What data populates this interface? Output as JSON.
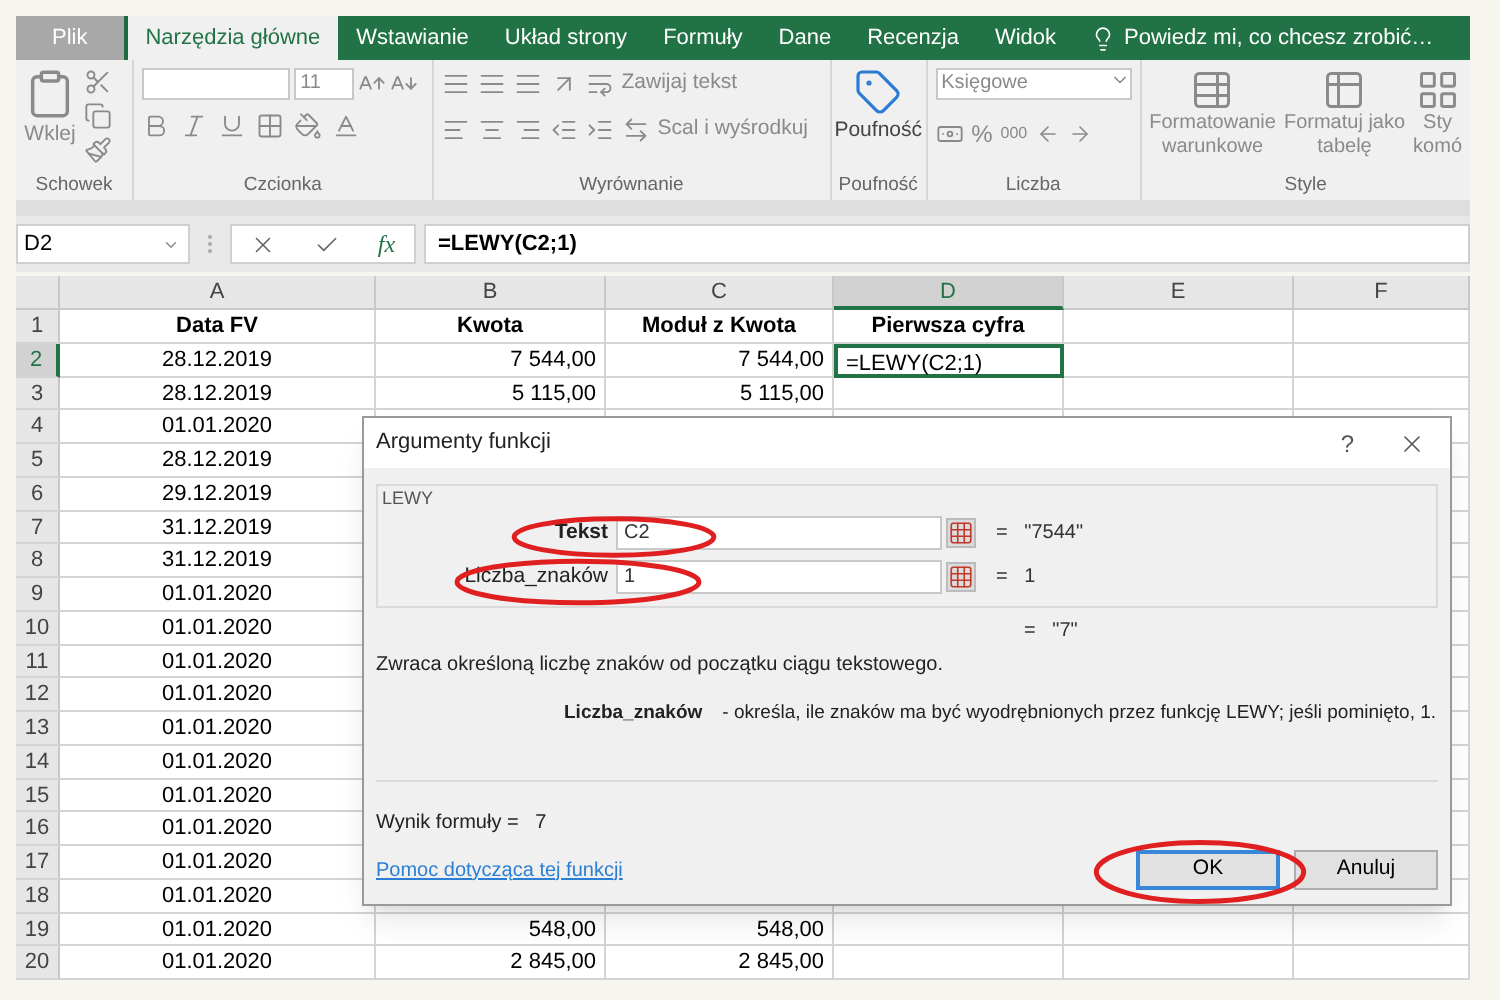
{
  "ribbon_tabs": [
    {
      "label": "Plik",
      "selected": false,
      "kind": "file"
    },
    {
      "label": "Narzędzia główne",
      "selected": true,
      "kind": "tab"
    },
    {
      "label": "Wstawianie",
      "selected": false,
      "kind": "tab"
    },
    {
      "label": "Układ strony",
      "selected": false,
      "kind": "tab"
    },
    {
      "label": "Formuły",
      "selected": false,
      "kind": "tab"
    },
    {
      "label": "Dane",
      "selected": false,
      "kind": "tab"
    },
    {
      "label": "Recenzja",
      "selected": false,
      "kind": "tab"
    },
    {
      "label": "Widok",
      "selected": false,
      "kind": "tab"
    }
  ],
  "tell_me": "Powiedz mi, co chcesz zrobić…",
  "ribbon": {
    "clipboard": {
      "paste": "Wklej",
      "label": "Schowek"
    },
    "font": {
      "size": "11",
      "label": "Czcionka"
    },
    "alignment": {
      "wrap": "Zawijaj tekst",
      "merge": "Scal i wyśrodkuj",
      "label": "Wyrównanie"
    },
    "sensitivity": {
      "button": "Poufność",
      "label": "Poufność"
    },
    "number": {
      "format": "Księgowe",
      "percent": "%",
      "thousands": "000",
      "label": "Liczba"
    },
    "styles": {
      "buttons": [
        {
          "lines": [
            "Formatowanie",
            "warunkowe"
          ]
        },
        {
          "lines": [
            "Formatuj jako",
            "tabelę"
          ]
        },
        {
          "lines": [
            "Sty",
            "komó"
          ]
        }
      ],
      "label": "Style"
    }
  },
  "formula_bar": {
    "name_box": "D2",
    "function_button": "fx",
    "formula": "=LEWY(C2;1)"
  },
  "columns": [
    {
      "label": "A",
      "selected": false
    },
    {
      "label": "B",
      "selected": false
    },
    {
      "label": "C",
      "selected": false
    },
    {
      "label": "D",
      "selected": true
    },
    {
      "label": "E",
      "selected": false
    },
    {
      "label": "F",
      "selected": false
    }
  ],
  "rows": [
    {
      "number": "1",
      "selected": false,
      "kind": "header",
      "cells": [
        "Data FV",
        "Kwota",
        "Moduł z Kwota",
        "Pierwsza cyfra"
      ]
    },
    {
      "number": "2",
      "selected": true,
      "kind": "data",
      "cells": [
        "28.12.2019",
        "7 544,00",
        "7 544,00",
        "=LEWY(C2;1)"
      ]
    },
    {
      "number": "3",
      "selected": false,
      "kind": "data",
      "cells": [
        "28.12.2019",
        "5 115,00",
        "5 115,00"
      ]
    },
    {
      "number": "4",
      "selected": false,
      "kind": "data",
      "cells": [
        "01.01.2020"
      ]
    },
    {
      "number": "5",
      "selected": false,
      "kind": "data",
      "cells": [
        "28.12.2019"
      ]
    },
    {
      "number": "6",
      "selected": false,
      "kind": "data",
      "cells": [
        "29.12.2019"
      ]
    },
    {
      "number": "7",
      "selected": false,
      "kind": "data",
      "cells": [
        "31.12.2019"
      ]
    },
    {
      "number": "8",
      "selected": false,
      "kind": "data",
      "cells": [
        "31.12.2019"
      ]
    },
    {
      "number": "9",
      "selected": false,
      "kind": "data",
      "cells": [
        "01.01.2020"
      ]
    },
    {
      "number": "10",
      "selected": false,
      "kind": "data",
      "cells": [
        "01.01.2020"
      ]
    },
    {
      "number": "11",
      "selected": false,
      "kind": "data",
      "cells": [
        "01.01.2020"
      ]
    },
    {
      "number": "12",
      "selected": false,
      "kind": "data",
      "cells": [
        "01.01.2020"
      ]
    },
    {
      "number": "13",
      "selected": false,
      "kind": "data",
      "cells": [
        "01.01.2020"
      ]
    },
    {
      "number": "14",
      "selected": false,
      "kind": "data",
      "cells": [
        "01.01.2020"
      ]
    },
    {
      "number": "15",
      "selected": false,
      "kind": "data",
      "cells": [
        "01.01.2020"
      ]
    },
    {
      "number": "16",
      "selected": false,
      "kind": "data",
      "cells": [
        "01.01.2020"
      ]
    },
    {
      "number": "17",
      "selected": false,
      "kind": "data",
      "cells": [
        "01.01.2020"
      ]
    },
    {
      "number": "18",
      "selected": false,
      "kind": "data",
      "cells": [
        "01.01.2020"
      ]
    },
    {
      "number": "19",
      "selected": false,
      "kind": "data",
      "cells": [
        "01.01.2020",
        "548,00",
        "548,00"
      ]
    },
    {
      "number": "20",
      "selected": false,
      "kind": "data",
      "cells": [
        "01.01.2020",
        "2 845,00",
        "2 845,00"
      ]
    }
  ],
  "dialog": {
    "title": "Argumenty funkcji",
    "help": "?",
    "function_name": "LEWY",
    "arguments": [
      {
        "label": "Tekst",
        "value": "C2",
        "result": "=   \"7544\"",
        "required": true,
        "circled": true
      },
      {
        "label": "Liczba_znaków",
        "value": "1",
        "result": "=   1",
        "required": false,
        "circled": true
      }
    ],
    "result_preview": "=   \"7\"",
    "description": "Zwraca określoną liczbę znaków od początku ciągu tekstowego.",
    "argument_help": {
      "name": "Liczba_znaków",
      "text": "- określa, ile znaków ma być wyodrębnionych przez funkcję LEWY; jeśli pominięto, 1."
    },
    "formula_result": "Wynik formuły =   7",
    "help_link": "Pomoc dotycząca tej funkcji",
    "buttons": [
      {
        "label": "OK",
        "default": true,
        "circled": true
      },
      {
        "label": "Anuluj",
        "default": false,
        "circled": false
      }
    ]
  }
}
